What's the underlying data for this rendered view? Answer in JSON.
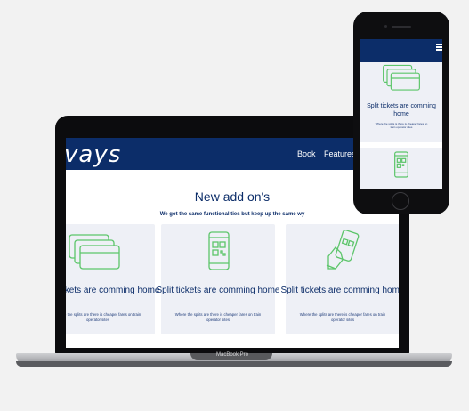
{
  "laptop": {
    "model_label": "MacBook Pro",
    "site": {
      "logo_text": "vays",
      "nav": {
        "book_label": "Book",
        "features_label": "Features"
      },
      "section": {
        "title": "New add on's",
        "subtitle": "We got the same functionalities but keep up the same wy"
      },
      "cards": [
        {
          "title": "Split tickets are comming home",
          "text": "Where the splits are there is cheaper fares on train operator sites",
          "icon": "tickets-icon"
        },
        {
          "title": "Split tickets are comming home",
          "text": "Where the splits are there is cheaper fares on train operator sites",
          "icon": "qr-phone-icon"
        },
        {
          "title": "Split tickets are comming home",
          "text": "Where the splits are there is cheaper fares on train operator sites",
          "icon": "hand-phone-icon"
        }
      ]
    }
  },
  "phone": {
    "cards": [
      {
        "title": "Split tickets are comming home",
        "text": "Where the splits is there is cheaper fares on train operator sites",
        "icon": "tickets-icon"
      },
      {
        "title": "",
        "text": "",
        "icon": "qr-phone-icon"
      }
    ]
  },
  "colors": {
    "brand_navy": "#0c2d69",
    "icon_green": "#5cc56a",
    "card_bg": "#eef0f6",
    "background": "#f2f2f2"
  }
}
